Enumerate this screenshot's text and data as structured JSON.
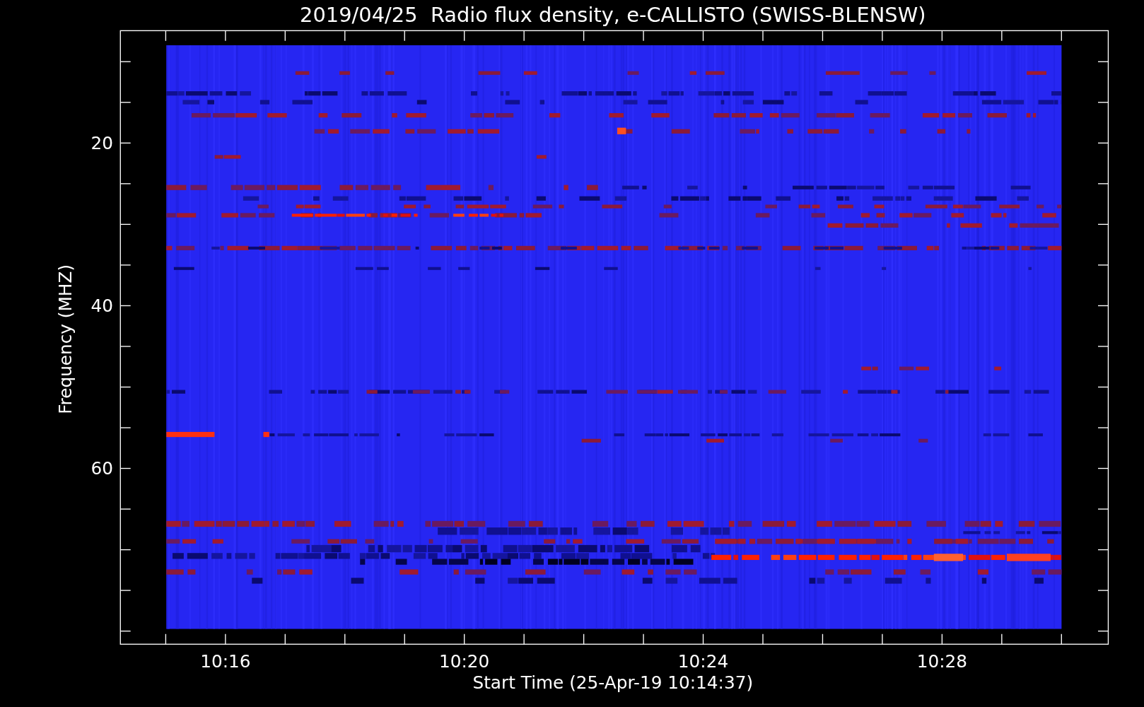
{
  "title": "2019/04/25  Radio flux density, e-CALLISTO (SWISS-BLENSW)",
  "plot": {
    "y_axis": {
      "label": "Frequency (MHZ)",
      "ticks": [
        "20",
        "40",
        "60"
      ]
    },
    "x_axis": {
      "label": "Start Time (25-Apr-19 10:14:37)",
      "ticks": [
        "10:16",
        "10:20",
        "10:24",
        "10:28"
      ]
    }
  }
}
